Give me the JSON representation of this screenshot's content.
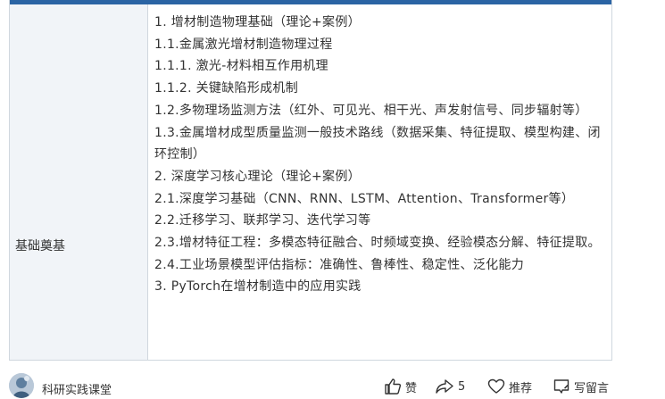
{
  "table": {
    "left_label": "基础奠基",
    "lines": [
      "1.  增材制造物理基础（理论+案例）",
      "1.1.金属激光增材制造物理过程",
      "1.1.1. 激光-材料相互作用机理",
      "1.1.2. 关键缺陷形成机制",
      "1.2.多物理场监测方法（红外、可见光、相干光、声发射信号、同步辐射等）",
      "1.3.金属增材成型质量监测一般技术路线（数据采集、特征提取、模型构建、闭环控制）",
      "2.  深度学习核心理论（理论+案例）",
      "2.1.深度学习基础（CNN、RNN、LSTM、Attention、Transformer等）",
      "2.2.迁移学习、联邦学习、迭代学习等",
      "2.3.增材特征工程：多模态特征融合、时频域变换、经验模态分解、特征提取。",
      "2.4.工业场景模型评估指标：准确性、鲁棒性、稳定性、泛化能力",
      "3.  PyTorch在增材制造中的应用实践"
    ]
  },
  "footer": {
    "account_name": "科研实践课堂",
    "like_label": "赞",
    "share_count": "5",
    "recommend_label": "推荐",
    "comment_label": "写留言"
  },
  "colors": {
    "header_bar": "#2b64a4",
    "left_cell_bg": "#f1f4f8",
    "border": "#d0d7de",
    "text": "#333333"
  },
  "icons": [
    "avatar",
    "thumbs-up-icon",
    "share-icon",
    "heart-icon",
    "comment-icon"
  ]
}
